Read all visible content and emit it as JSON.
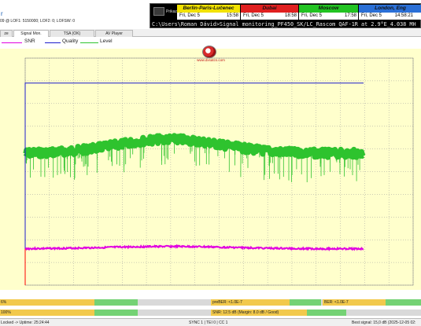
{
  "app": {
    "title_fragment": "r",
    "lof_info": "09 @ LOF1: 5150000; LOF2: 0; LOFSW: 0"
  },
  "tabs": [
    {
      "label": "ze",
      "active": false
    },
    {
      "label": "Signal Mon.",
      "active": true
    },
    {
      "label": "TSA (OK)",
      "active": false
    },
    {
      "label": "AV Player",
      "active": false
    }
  ],
  "legend": [
    {
      "label": "SNR",
      "color": "#e100e1"
    },
    {
      "label": "Quality",
      "color": "#1c1ccc"
    },
    {
      "label": "Level",
      "color": "#2ec32e"
    }
  ],
  "logo": {
    "text": "www.dxsatcs.com"
  },
  "status": {
    "row1_left": "6%",
    "prober": "preBER: <1.0E-7",
    "ber": "BER: <1.0E-7",
    "row2_left": "100%",
    "snr": "SNR: 12.5 dB (Margin: 8.0 dB / Good)"
  },
  "footer": {
    "locked": "Locked -> Uptime: 25:24:44",
    "sync": "SYNC 1 | TEI 0 | CC 1",
    "best": "Best signal: 15,0 dB (2025-12-05 02:"
  },
  "clock": {
    "prikaz": "Prikaz",
    "cities": [
      {
        "name": "Berlin-Paris-Lučenec",
        "date": "Fri, Dec 5",
        "time": "15:58",
        "color": "#f2e200"
      },
      {
        "name": "Dubai",
        "date": "Fri, Dec 5",
        "time": "18:58",
        "color": "#e02020"
      },
      {
        "name": "Moscow",
        "date": "Fri, Dec 5",
        "time": "17:58",
        "color": "#22c322"
      },
      {
        "name": "London, Eng",
        "date": "Fri, Dec 5",
        "time": "14:58:21",
        "color": "#2a6fd6"
      }
    ],
    "command": "C:\\Users\\Roman Dávid>Signal monitoring_PF450_SK/LC_Rascom QAF-1R at 2.9°E_4.038 MH"
  },
  "chart_data": {
    "type": "line",
    "title": "",
    "xlabel": "",
    "ylabel": "",
    "grid": true,
    "series": [
      {
        "name": "SNR",
        "color": "#e100e1",
        "level": 0.16
      },
      {
        "name": "Quality",
        "color": "#1c1ccc",
        "level": 0.89
      },
      {
        "name": "Level",
        "color": "#2ec32e",
        "level": 0.58
      }
    ]
  }
}
